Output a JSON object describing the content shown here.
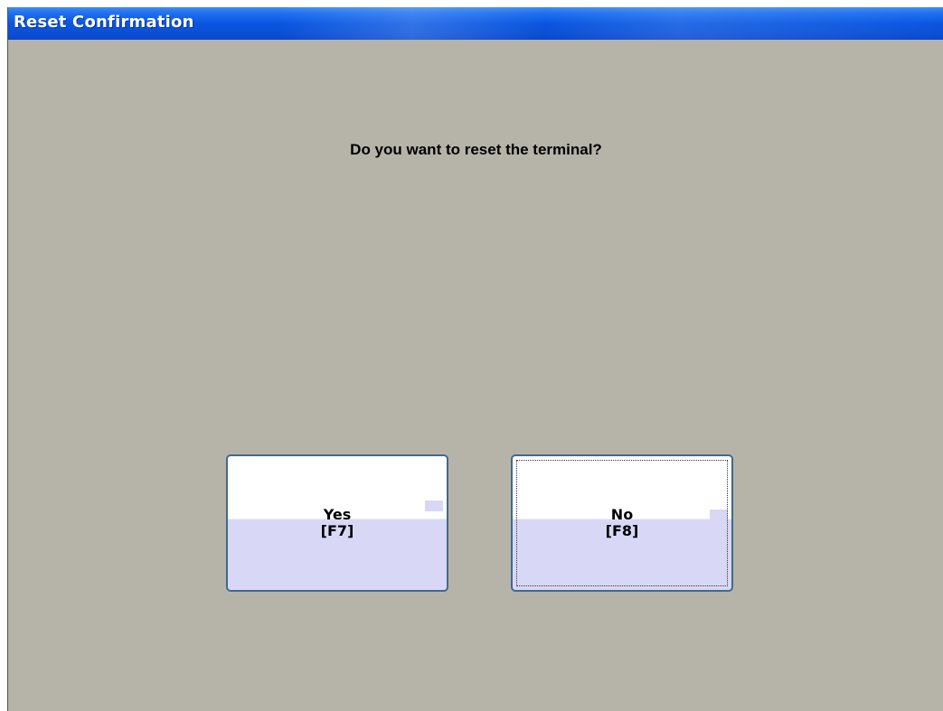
{
  "window": {
    "title": "Reset Confirmation"
  },
  "dialog": {
    "question": "Do you want to reset the terminal?",
    "buttons": [
      {
        "label": "Yes",
        "shortcut": "[F7]",
        "focused": false
      },
      {
        "label": "No",
        "shortcut": "[F8]",
        "focused": true
      }
    ]
  },
  "colors": {
    "window_background": "#b6b4a9",
    "titlebar_blue": "#0a56e0",
    "button_border": "#416a8a",
    "button_lower_fill": "#d8d8f6"
  }
}
